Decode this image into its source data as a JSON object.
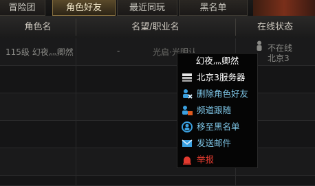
{
  "tabs": [
    {
      "label": "冒险团"
    },
    {
      "label": "角色好友"
    },
    {
      "label": "最近同玩"
    },
    {
      "label": "黑名单"
    }
  ],
  "table": {
    "headers": [
      "角色名",
      "名望/职业名",
      "在线状态"
    ],
    "rows": [
      {
        "name": "115级 幻夜灬卿然",
        "fame": "-",
        "job": "光启·光明认...",
        "status": "不在线",
        "server": "北京3"
      }
    ]
  },
  "context_menu": {
    "title": "幻夜灬卿然",
    "items": [
      {
        "label": "北京3服务器",
        "icon": "server-icon",
        "color": "#ffffff"
      },
      {
        "label": "删除角色好友",
        "icon": "delete-friend-icon",
        "color": "#7fc7e8"
      },
      {
        "label": "频道跟随",
        "icon": "channel-follow-icon",
        "color": "#7fc7e8"
      },
      {
        "label": "移至黑名单",
        "icon": "blacklist-icon",
        "color": "#7fc7e8"
      },
      {
        "label": "发送邮件",
        "icon": "mail-icon",
        "color": "#7fc7e8"
      },
      {
        "label": "举报",
        "icon": "report-icon",
        "color": "#e23a2f"
      }
    ]
  },
  "colors": {
    "accent_tab": "#8b7341",
    "menu_text": "#7fc7e8",
    "report_text": "#e23a2f"
  }
}
